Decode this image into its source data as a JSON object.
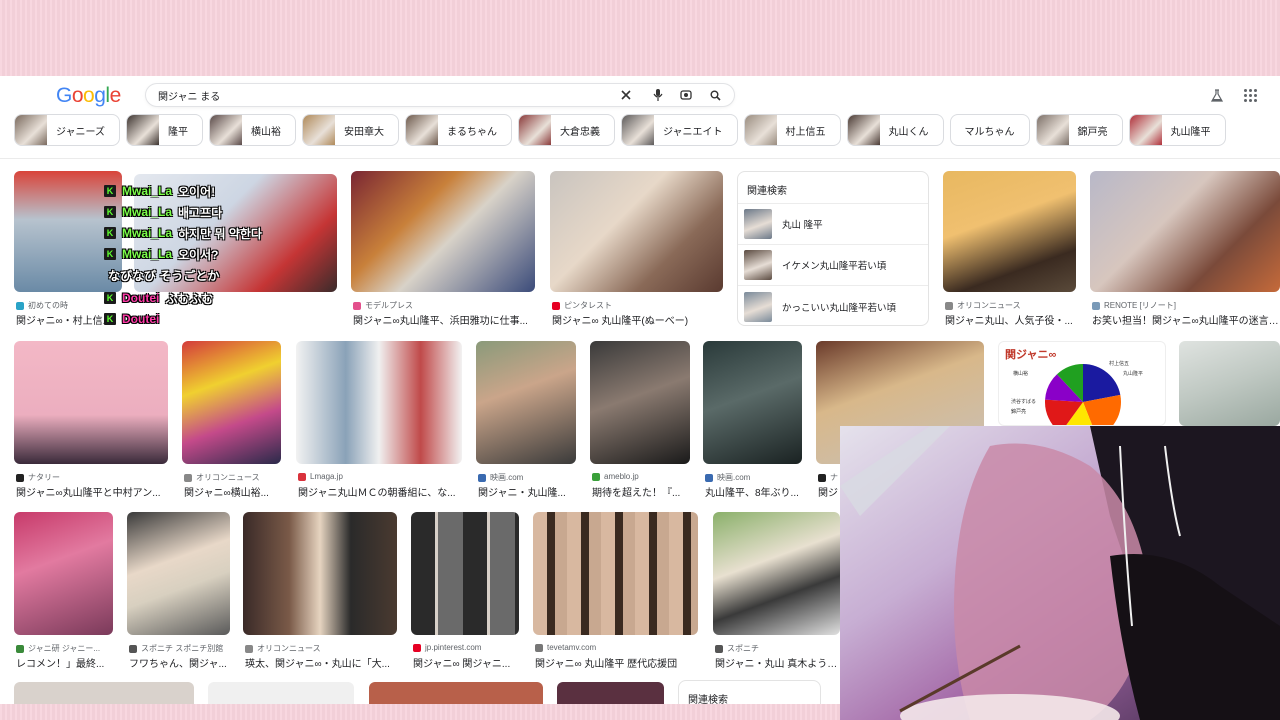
{
  "search": {
    "logo_letters": [
      "G",
      "o",
      "o",
      "g",
      "l",
      "e"
    ],
    "logo_colors": [
      "#4285f4",
      "#ea4335",
      "#fbbc05",
      "#4285f4",
      "#34a853",
      "#ea4335"
    ],
    "query": "関ジャニ まる",
    "icons": [
      "close-icon",
      "mic-icon",
      "lens-icon",
      "search-icon"
    ]
  },
  "header_icons": [
    "labs-flask-icon",
    "apps-grid-icon"
  ],
  "chips": [
    {
      "label": "ジャニーズ",
      "thumb": "#7a6a5e"
    },
    {
      "label": "隆平",
      "thumb": "#3d3430"
    },
    {
      "label": "横山裕",
      "thumb": "#5a4a48"
    },
    {
      "label": "安田章大",
      "thumb": "#b08a5a"
    },
    {
      "label": "まるちゃん",
      "thumb": "#6d5a4d"
    },
    {
      "label": "大倉忠義",
      "thumb": "#8a3a3a"
    },
    {
      "label": "ジャニエイト",
      "thumb": "#5d5a5a"
    },
    {
      "label": "村上信五",
      "thumb": "#9a8d80"
    },
    {
      "label": "丸山くん",
      "thumb": "#4a3a34"
    },
    {
      "label": "マルちゃん",
      "thumb": ""
    },
    {
      "label": "錦戸亮",
      "thumb": "#7c7068"
    },
    {
      "label": "丸山隆平",
      "thumb": "#b0303a"
    }
  ],
  "row1": [
    {
      "source": "初めての時",
      "title": "関ジャニ∞・村上信...",
      "fav": "#2aa3c7",
      "img": "linear-gradient(180deg,#d9443a 0%,#b7c3ce 40%,#6a8aa6 100%)"
    },
    {
      "source": "",
      "title": "",
      "fav": "",
      "img": "linear-gradient(135deg,#e4e8ef 0%,#cdd6e3 40%,#c53535 75%,#3a2b2b 100%)"
    },
    {
      "source": "モデルプレス",
      "title": "関ジャニ∞丸山隆平、浜田雅功に仕事...",
      "fav": "#e3508c",
      "img": "linear-gradient(135deg,#7a2633 0%,#c8803a 35%,#d8d2c8 55%,#3b4b7a 100%)"
    },
    {
      "source": "ピンタレスト",
      "title": "関ジャニ∞ 丸山隆平(ぬーべー)",
      "fav": "#e60023",
      "img": "linear-gradient(135deg,#c9c4bf 0%,#e7d8c8 40%,#8a6a58 70%,#5a3a30 100%)"
    },
    {
      "source": "オリコンニュース",
      "title": "関ジャニ丸山、人気子役・...",
      "fav": "#888888",
      "img": "linear-gradient(160deg,#e8b860 0%,#f0c070 40%,#3a2a20 75%,#5a4a3a 100%)"
    },
    {
      "source": "RENOTE [リノート]",
      "title": "お笑い担当！関ジャニ∞丸山隆平の迷言と...",
      "fav": "#7a9ab8",
      "img": "linear-gradient(135deg,#b8b8c8 0%,#d7c6be 40%,#7a4a3a 70%,#c56a3a 100%)"
    }
  ],
  "related1": {
    "heading": "関連検索",
    "items": [
      {
        "label": "丸山 隆平",
        "thumb": "#6b7888"
      },
      {
        "label": "イケメン丸山隆平若い頃",
        "thumb": "#5a4a40"
      },
      {
        "label": "かっこいい丸山隆平若い頃",
        "thumb": "#7a8a9a"
      }
    ]
  },
  "row2": [
    {
      "source": "ナタリー",
      "title": "関ジャニ∞丸山隆平と中村アン...",
      "fav": "#222222",
      "img": "linear-gradient(180deg,#f3b8c6 0%,#ecaebf 60%,#3a2a3a 100%)"
    },
    {
      "source": "オリコンニュース",
      "title": "関ジャニ∞横山裕...",
      "fav": "#888888",
      "img": "linear-gradient(160deg,#d33b3b 0%,#f0d030 35%,#c44a8a 65%,#2a2a4a 100%)"
    },
    {
      "source": "Lmaga.jp",
      "title": "関ジャニ丸山ＭＣの朝番組に、な...",
      "fav": "#d9323c",
      "img": "linear-gradient(90deg,#f2f2f2 0%,#8aa2b8 30%,#f0f0f0 50%,#c04a4a 75%,#f2f2f2 100%)"
    },
    {
      "source": "映画.com",
      "title": "関ジャニ・丸山隆...",
      "fav": "#3a6ab0",
      "img": "linear-gradient(160deg,#8a9a7a 0%,#caa58a 40%,#3a3a3a 100%)"
    },
    {
      "source": "ameblo.jp",
      "title": "期待を超えた！『...",
      "fav": "#3aa03a",
      "img": "linear-gradient(160deg,#3a3a3a 0%,#8a7a70 45%,#1a1a1a 100%)"
    },
    {
      "source": "映画.com",
      "title": "丸山隆平、8年ぶり...",
      "fav": "#3a6ab0",
      "img": "linear-gradient(160deg,#2a3a3a 0%,#5a6a68 45%,#1a2222 100%)"
    },
    {
      "source": "ナ",
      "title": "関ジ",
      "fav": "#222222",
      "img": "linear-gradient(160deg,#6a3a2a 0%,#d8b88a 40%,#c8c0b8 100%)"
    },
    {
      "source": "",
      "title": "",
      "fav": "",
      "img": "linear-gradient(180deg,#f6f6f6 0%,#ffffff 100%)"
    },
    {
      "source": "",
      "title": "",
      "fav": "",
      "img": "linear-gradient(160deg,#dfe3e0 0%,#bfc8c2 50%,#9aa8a0 100%)"
    }
  ],
  "pie_card": {
    "title": "関ジャニ∞",
    "legend": [
      "村上信五",
      "丸山隆平",
      "横山裕",
      "渋谷すばる",
      "錦戸亮"
    ],
    "colors": [
      "#1a1aa0",
      "#ff6a00",
      "#ffe600",
      "#e01818",
      "#8a00c8",
      "#20a020"
    ]
  },
  "row3": [
    {
      "source": "ジャニ研 ジャニー...",
      "title": "レコメン！」最終...",
      "fav": "#3a8a3a",
      "img": "linear-gradient(160deg,#c73a6a 0%,#e27aa0 40%,#7a3a5a 100%)"
    },
    {
      "source": "スポニチ スポニチ別館",
      "title": "フワちゃん、関ジャ...",
      "fav": "#555555",
      "img": "linear-gradient(160deg,#3a3a3a 0%,#e8d8c8 40%,#d8d0c0 60%,#5a5a5a 100%)"
    },
    {
      "source": "オリコンニュース",
      "title": "瑛太、関ジャニ∞・丸山に「大...",
      "fav": "#888888",
      "img": "linear-gradient(90deg,#3a2a28 0%,#7a5a48 30%,#e6d4c0 50%,#2a2a2a 70%,#4a3a30 100%)"
    },
    {
      "source": "jp.pinterest.com",
      "title": "関ジャニ∞ 関ジャニ...",
      "fav": "#e60023",
      "img": "repeating-linear-gradient(90deg,#2a2a2a 0 24px,#d8d0c8 24px 27px,#6a6a6a 27px 52px)"
    },
    {
      "source": "tevetamv.com",
      "title": "関ジャニ∞ 丸山隆平 歴代応援団",
      "fav": "#777777",
      "img": "repeating-linear-gradient(90deg,#d8b8a0 0 14px,#3a2a20 14px 22px,#c8a890 22px 34px)"
    },
    {
      "source": "スポニチ",
      "title": "関ジャニ・丸山 真木よう子に...",
      "fav": "#555555",
      "img": "linear-gradient(160deg,#8ab06a 0%,#e8e0d0 40%,#3a3a3a 65%,#e0e0e0 100%)"
    }
  ],
  "row4": [
    {
      "img": "#d9d2cc"
    },
    {
      "img": "#f0f0f0"
    },
    {
      "img": "#b8604a"
    },
    {
      "img": "#5a3040"
    }
  ],
  "related2": {
    "heading": "関連検索"
  },
  "chat": [
    {
      "badge": "K",
      "user": "Mwai_La",
      "user_color": "#7cff4a",
      "msg": "오이어!"
    },
    {
      "badge": "K",
      "user": "Mwai_La",
      "user_color": "#7cff4a",
      "msg": "배고프다"
    },
    {
      "badge": "K",
      "user": "Mwai_La",
      "user_color": "#7cff4a",
      "msg": "하지만 뭐 약한다"
    },
    {
      "badge": "K",
      "user": "Mwai_La",
      "user_color": "#7cff4a",
      "msg": "오이서?"
    },
    {
      "badge": "",
      "user": "",
      "user_color": "#ffffff",
      "msg": "なびなび そうごとか"
    },
    {
      "badge": "K",
      "user": "Doutei",
      "user_color": "#ff3aa8",
      "msg": "ふむふむ"
    },
    {
      "badge": "K",
      "user": "Doutei",
      "user_color": "#ff3aa8",
      "msg": ""
    }
  ]
}
